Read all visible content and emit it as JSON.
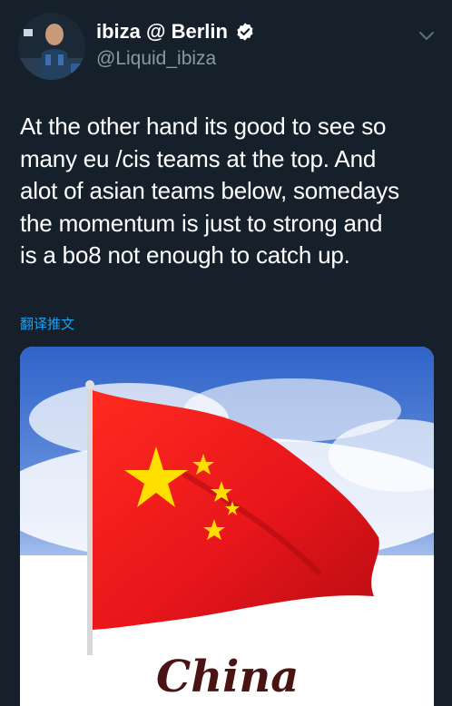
{
  "user": {
    "display_name": "ibiza @ Berlin",
    "handle": "@Liquid_ibiza",
    "avatar": "avatar-photo",
    "verified": true
  },
  "icons": {
    "verified": "verified-badge-icon",
    "menu": "chevron-down-icon"
  },
  "tweet": {
    "lines": [
      "At the other hand its good to see so",
      "many eu /cis teams at the top. And",
      "alot of asian teams below, somedays",
      "the momentum is just to strong and",
      "is a bo8 not enough to catch up."
    ],
    "translate_label": "翻译推文"
  },
  "media": {
    "caption": "China"
  },
  "colors": {
    "background": "#15202b",
    "secondary_text": "#8899a6",
    "link": "#1da1f2",
    "flag_red": "#e8161b",
    "flag_star": "#ffde00"
  }
}
